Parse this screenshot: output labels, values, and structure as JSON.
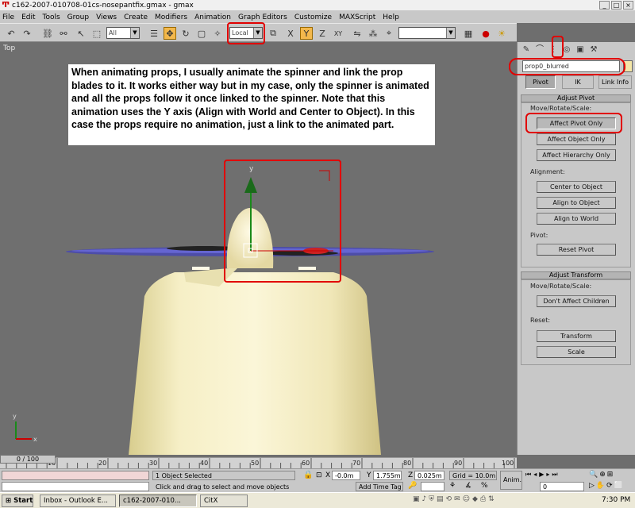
{
  "window": {
    "title": "c162-2007-010708-01cs-nosepantfix.gmax - gmax",
    "minimize": "_",
    "maximize": "□",
    "close": "×"
  },
  "menu": [
    "File",
    "Edit",
    "Tools",
    "Group",
    "Views",
    "Create",
    "Modifiers",
    "Animation",
    "Graph Editors",
    "Customize",
    "MAXScript",
    "Help"
  ],
  "toolbar": {
    "selection_filter": "All",
    "coord_system": "Local",
    "axis_x": "X",
    "axis_y": "Y",
    "axis_z": "Z",
    "axis_xy": "XY"
  },
  "viewport": {
    "label": "Top",
    "note": "When animating props, I usually animate the spinner and link the prop blades to it.  It works either way but in my case, only the spinner is animated and all the props follow it once linked to the spinner.  Note that this animation uses the Y axis (Align with World and Center to Object).  In this case the props require no animation, just a link to the animated part.",
    "gizmo_axis": "y",
    "axis_tripod_y": "y",
    "axis_tripod_x": "x"
  },
  "command_panel": {
    "object_name": "prop0_blurred",
    "color": "#f4e7a8",
    "tabs": [
      "Pivot",
      "IK",
      "Link Info"
    ],
    "adjust_pivot": {
      "header": "Adjust Pivot",
      "move_label": "Move/Rotate/Scale:",
      "buttons": [
        "Affect Pivot Only",
        "Affect Object Only",
        "Affect Hierarchy Only"
      ]
    },
    "alignment": {
      "label": "Alignment:",
      "buttons": [
        "Center to Object",
        "Align to Object",
        "Align to World"
      ]
    },
    "pivot": {
      "label": "Pivot:",
      "button": "Reset Pivot"
    },
    "adjust_transform": {
      "header": "Adjust Transform",
      "move_label": "Move/Rotate/Scale:",
      "button": "Don't Affect Children",
      "reset_label": "Reset:",
      "reset_buttons": [
        "Transform",
        "Scale"
      ]
    }
  },
  "timeline": {
    "slider": "0 / 100",
    "ticks": [
      "10",
      "20",
      "30",
      "40",
      "50",
      "60",
      "70",
      "80",
      "90",
      "100"
    ]
  },
  "status": {
    "selection": "1 Object Selected",
    "prompt": "Click and drag to select and move objects",
    "x_label": "X",
    "x_value": "-0.0m",
    "y_label": "Y",
    "y_value": "1.755m",
    "z_label": "Z",
    "z_value": "0.025m",
    "grid": "Grid = 10.0m",
    "add_time_tag": "Add Time Tag",
    "anim": "Anim.",
    "frame": "0"
  },
  "taskbar": {
    "start": "Start",
    "items": [
      "Inbox - Outlook E...",
      "c162-2007-010...",
      "CitX"
    ],
    "clock": "7:30 PM"
  }
}
